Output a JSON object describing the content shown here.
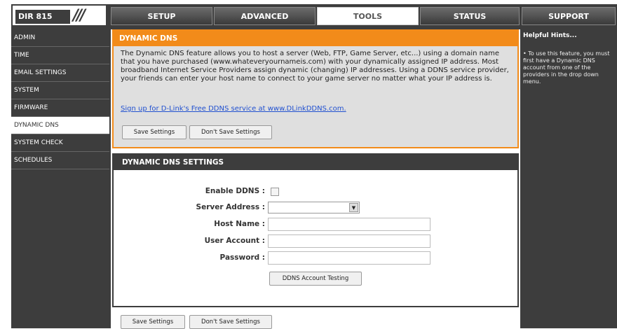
{
  "header": {
    "model": "DIR 815",
    "logo_slashes": "///",
    "tabs": [
      {
        "label": "SETUP"
      },
      {
        "label": "ADVANCED"
      },
      {
        "label": "TOOLS"
      },
      {
        "label": "STATUS"
      },
      {
        "label": "SUPPORT"
      }
    ],
    "active_tab": "TOOLS"
  },
  "nav": {
    "items": [
      {
        "label": "ADMIN"
      },
      {
        "label": "TIME"
      },
      {
        "label": "EMAIL SETTINGS"
      },
      {
        "label": "SYSTEM"
      },
      {
        "label": "FIRMWARE"
      },
      {
        "label": "DYNAMIC DNS"
      },
      {
        "label": "SYSTEM CHECK"
      },
      {
        "label": "SCHEDULES"
      }
    ],
    "active_item": "DYNAMIC DNS"
  },
  "intro": {
    "title": "DYNAMIC DNS",
    "text": "The Dynamic DNS feature allows you to host a server (Web, FTP, Game Server, etc...) using a domain name that you have purchased (www.whateveryournameis.com) with your dynamically assigned IP address. Most broadband Internet Service Providers assign dynamic (changing) IP addresses. Using a DDNS service provider, your friends can enter your host name to connect to your game server no matter what your IP address is.",
    "link": "Sign up for D-Link's Free DDNS service at www.DLinkDDNS.com.",
    "save_label": "Save Settings",
    "dont_save_label": "Don't Save Settings"
  },
  "settings": {
    "title": "DYNAMIC DNS SETTINGS",
    "enable_label": "Enable DDNS :",
    "enable_checked": false,
    "server_label": "Server Address :",
    "server_value": "",
    "host_label": "Host Name :",
    "host_value": "",
    "user_label": "User Account :",
    "user_value": "",
    "password_label": "Password :",
    "password_value": "",
    "test_label": "DDNS Account Testing"
  },
  "footer": {
    "save_label": "Save Settings",
    "dont_save_label": "Don't Save Settings"
  },
  "hints": {
    "title": "Helpful Hints...",
    "text": "• To use this feature, you must first have a Dynamic DNS account from one of the providers in the drop down menu."
  },
  "colors": {
    "accent": "#f28b1a",
    "frame": "#3d3d3d",
    "link": "#2050d0"
  }
}
